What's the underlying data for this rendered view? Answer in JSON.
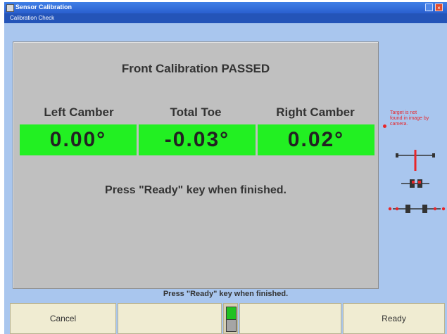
{
  "window": {
    "title": "Sensor Calibration",
    "subtitle": "Calibration Check",
    "title_bar_color": "#2a5fcf",
    "background_color": "#a9c6ee"
  },
  "result": {
    "title": "Front Calibration PASSED",
    "columns": [
      {
        "label": "Left Camber",
        "value": "0.00°"
      },
      {
        "label": "Total Toe",
        "value": "-0.03°"
      },
      {
        "label": "Right Camber",
        "value": "0.02°"
      }
    ],
    "value_color": "#22f022",
    "instruction": "Press \"Ready\" key when finished."
  },
  "side": {
    "message": "Target is not found in image by camera.",
    "accent_color": "#e8262a"
  },
  "status_text": "Press \"Ready\" key when finished.",
  "buttons": {
    "cancel": "Cancel",
    "blank1": "",
    "blank2": "",
    "ready": "Ready"
  },
  "icons": {
    "wheel_diagram": "vehicle-axle-diagram-icon",
    "toggle": "green-toggle-indicator"
  }
}
